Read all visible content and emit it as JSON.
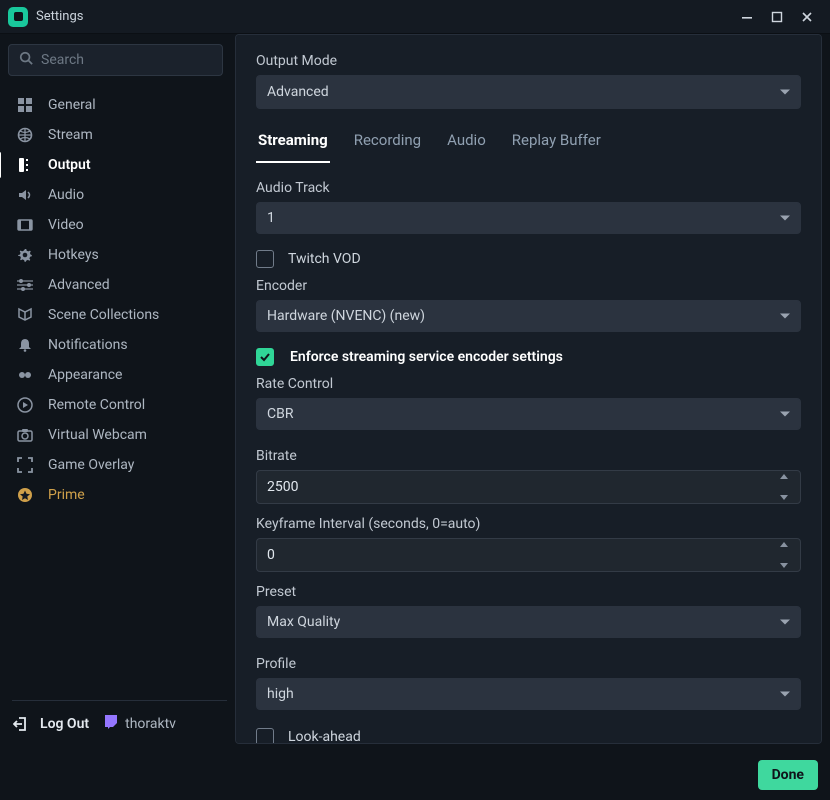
{
  "window": {
    "title": "Settings"
  },
  "search": {
    "placeholder": "Search"
  },
  "sidebar": {
    "items": [
      {
        "label": "General",
        "icon": "grid-icon"
      },
      {
        "label": "Stream",
        "icon": "globe-icon"
      },
      {
        "label": "Output",
        "icon": "output-icon",
        "active": true
      },
      {
        "label": "Audio",
        "icon": "volume-icon"
      },
      {
        "label": "Video",
        "icon": "film-icon"
      },
      {
        "label": "Hotkeys",
        "icon": "gear-icon"
      },
      {
        "label": "Advanced",
        "icon": "sliders-icon"
      },
      {
        "label": "Scene Collections",
        "icon": "collections-icon"
      },
      {
        "label": "Notifications",
        "icon": "bell-icon"
      },
      {
        "label": "Appearance",
        "icon": "appearance-icon"
      },
      {
        "label": "Remote Control",
        "icon": "play-circle-icon"
      },
      {
        "label": "Virtual Webcam",
        "icon": "camera-icon"
      },
      {
        "label": "Game Overlay",
        "icon": "expand-icon"
      },
      {
        "label": "Prime",
        "icon": "prime-icon",
        "prime": true
      }
    ],
    "logout_label": "Log Out",
    "username": "thoraktv"
  },
  "output": {
    "output_mode": {
      "label": "Output Mode",
      "value": "Advanced"
    },
    "tabs": [
      "Streaming",
      "Recording",
      "Audio",
      "Replay Buffer"
    ],
    "active_tab": 0,
    "audio_track": {
      "label": "Audio Track",
      "value": "1"
    },
    "twitch_vod": {
      "label": "Twitch VOD",
      "checked": false
    },
    "encoder": {
      "label": "Encoder",
      "value": "Hardware (NVENC) (new)"
    },
    "enforce": {
      "label": "Enforce streaming service encoder settings",
      "checked": true
    },
    "rate_control": {
      "label": "Rate Control",
      "value": "CBR"
    },
    "bitrate": {
      "label": "Bitrate",
      "value": "2500"
    },
    "keyframe": {
      "label": "Keyframe Interval (seconds, 0=auto)",
      "value": "0"
    },
    "preset": {
      "label": "Preset",
      "value": "Max Quality"
    },
    "profile": {
      "label": "Profile",
      "value": "high"
    },
    "lookahead": {
      "label": "Look-ahead",
      "checked": false
    }
  },
  "done_label": "Done"
}
